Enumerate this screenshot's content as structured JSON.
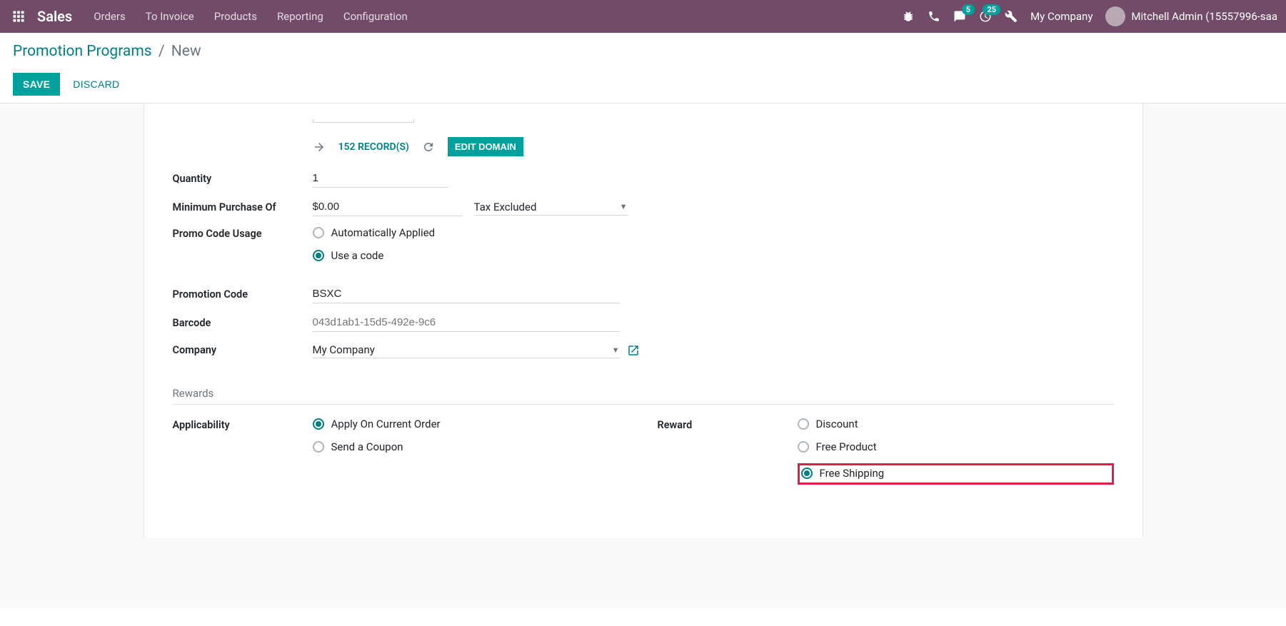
{
  "topnav": {
    "brand": "Sales",
    "menu": [
      "Orders",
      "To Invoice",
      "Products",
      "Reporting",
      "Configuration"
    ],
    "conversations_badge": "5",
    "activities_badge": "25",
    "company": "My Company",
    "user_name": "Mitchell Admin (15557996-saa"
  },
  "breadcrumb": {
    "parent": "Promotion Programs",
    "current": "New"
  },
  "buttons": {
    "save": "Save",
    "discard": "Discard",
    "edit_domain": "Edit Domain"
  },
  "records": {
    "count_label": "152 Record(s)"
  },
  "form": {
    "quantity_label": "Quantity",
    "quantity_value": "1",
    "min_purchase_label": "Minimum Purchase Of",
    "min_purchase_value": "$0.00",
    "tax_rule_value": "Tax Excluded",
    "promo_usage_label": "Promo Code Usage",
    "promo_usage_options": {
      "auto": "Automatically Applied",
      "code": "Use a code"
    },
    "promotion_code_label": "Promotion Code",
    "promotion_code_value": "BSXC",
    "barcode_label": "Barcode",
    "barcode_placeholder": "043d1ab1-15d5-492e-9c6",
    "company_label": "Company",
    "company_value": "My Company"
  },
  "rewards": {
    "section_title": "Rewards",
    "applicability_label": "Applicability",
    "applicability_options": {
      "current": "Apply On Current Order",
      "coupon": "Send a Coupon"
    },
    "reward_label": "Reward",
    "reward_options": {
      "discount": "Discount",
      "free_product": "Free Product",
      "free_shipping": "Free Shipping"
    }
  }
}
